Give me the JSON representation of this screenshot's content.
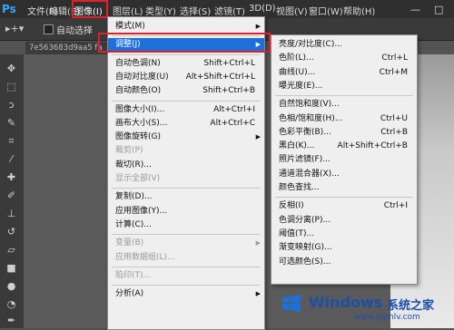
{
  "app": {
    "logo": "Ps"
  },
  "menubar": {
    "items": [
      "文件(F)",
      "编辑(E)",
      "图像(I)",
      "图层(L)",
      "类型(Y)",
      "选择(S)",
      "滤镜(T)",
      "3D(D)",
      "视图(V)",
      "窗口(W)",
      "帮助(H)"
    ],
    "active_index": 2,
    "window_controls": [
      "—",
      "□"
    ]
  },
  "options_bar": {
    "auto_select_label": "自动选择",
    "move_icon": "move-tool-icon"
  },
  "document": {
    "tab_label": "7e563683d9aa5 fa"
  },
  "image_menu": {
    "items": [
      {
        "label": "模式(M)",
        "submenu": true
      },
      {
        "sep": true
      },
      {
        "label": "调整(J)",
        "submenu": true,
        "highlighted": true
      },
      {
        "sep": true
      },
      {
        "label": "自动色调(N)",
        "shortcut": "Shift+Ctrl+L"
      },
      {
        "label": "自动对比度(U)",
        "shortcut": "Alt+Shift+Ctrl+L"
      },
      {
        "label": "自动颜色(O)",
        "shortcut": "Shift+Ctrl+B"
      },
      {
        "sep": true
      },
      {
        "label": "图像大小(I)...",
        "shortcut": "Alt+Ctrl+I"
      },
      {
        "label": "画布大小(S)...",
        "shortcut": "Alt+Ctrl+C"
      },
      {
        "label": "图像旋转(G)",
        "submenu": true
      },
      {
        "label": "裁剪(P)",
        "disabled": true
      },
      {
        "label": "裁切(R)..."
      },
      {
        "label": "显示全部(V)",
        "disabled": true
      },
      {
        "sep": true
      },
      {
        "label": "复制(D)..."
      },
      {
        "label": "应用图像(Y)..."
      },
      {
        "label": "计算(C)..."
      },
      {
        "sep": true
      },
      {
        "label": "变量(B)",
        "submenu": true,
        "disabled": true
      },
      {
        "label": "应用数据组(L)...",
        "disabled": true
      },
      {
        "sep": true
      },
      {
        "label": "陷印(T)...",
        "disabled": true
      },
      {
        "sep": true
      },
      {
        "label": "分析(A)",
        "submenu": true
      }
    ]
  },
  "adjust_menu": {
    "items": [
      {
        "label": "亮度/对比度(C)..."
      },
      {
        "label": "色阶(L)...",
        "shortcut": "Ctrl+L"
      },
      {
        "label": "曲线(U)...",
        "shortcut": "Ctrl+M"
      },
      {
        "label": "曝光度(E)..."
      },
      {
        "sep": true
      },
      {
        "label": "自然饱和度(V)..."
      },
      {
        "label": "色相/饱和度(H)...",
        "shortcut": "Ctrl+U"
      },
      {
        "label": "色彩平衡(B)...",
        "shortcut": "Ctrl+B"
      },
      {
        "label": "黑白(K)...",
        "shortcut": "Alt+Shift+Ctrl+B"
      },
      {
        "label": "照片滤镜(F)..."
      },
      {
        "label": "通道混合器(X)..."
      },
      {
        "label": "颜色查找..."
      },
      {
        "sep": true
      },
      {
        "label": "反相(I)",
        "shortcut": "Ctrl+I"
      },
      {
        "label": "色调分离(P)..."
      },
      {
        "label": "阈值(T)..."
      },
      {
        "label": "渐变映射(G)..."
      },
      {
        "label": "可选颜色(S)..."
      }
    ]
  },
  "watermark": {
    "title": "Windows",
    "cn": "系统之家",
    "url": "www.bjjmlv.com",
    "color": "#1d4fa8"
  },
  "colors": {
    "highlight": "#1e6fd9",
    "annotation": "#e0212b",
    "menubar": "#2f2f2f"
  }
}
